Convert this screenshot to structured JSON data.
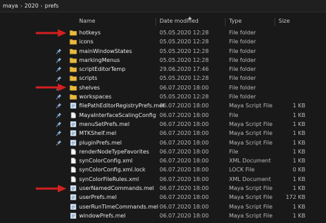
{
  "breadcrumbs": [
    "maya",
    "2020",
    "prefs"
  ],
  "columns": {
    "name": "Name",
    "date": "Date modified",
    "type": "Type",
    "size": "Size"
  },
  "icons": {
    "folder": "folder-icon",
    "file": "file-icon",
    "mel": "mel-script-icon",
    "pin": "pin-icon",
    "arrow": "red-arrow-icon"
  },
  "colors": {
    "folder": "#e8b83d",
    "arrow": "#d42020",
    "background": "#191919"
  },
  "files": [
    {
      "name": "hotkeys",
      "date": "05.05.2020 12:28",
      "type": "File folder",
      "size": "",
      "kind": "folder",
      "pinned": false,
      "arrow": true
    },
    {
      "name": "icons",
      "date": "05.05.2020 12:28",
      "type": "File folder",
      "size": "",
      "kind": "folder",
      "pinned": false,
      "arrow": false
    },
    {
      "name": "mainWindowStates",
      "date": "05.05.2020 12:28",
      "type": "File folder",
      "size": "",
      "kind": "folder",
      "pinned": true,
      "arrow": false
    },
    {
      "name": "markingMenus",
      "date": "05.05.2020 12:28",
      "type": "File folder",
      "size": "",
      "kind": "folder",
      "pinned": true,
      "arrow": false
    },
    {
      "name": "scriptEditorTemp",
      "date": "29.06.2020 17:46",
      "type": "File folder",
      "size": "",
      "kind": "folder",
      "pinned": true,
      "arrow": false
    },
    {
      "name": "scripts",
      "date": "05.05.2020 12:28",
      "type": "File folder",
      "size": "",
      "kind": "folder",
      "pinned": true,
      "arrow": false
    },
    {
      "name": "shelves",
      "date": "06.07.2020 18:00",
      "type": "File folder",
      "size": "",
      "kind": "folder",
      "pinned": true,
      "arrow": true
    },
    {
      "name": "workspaces",
      "date": "05.05.2020 12:28",
      "type": "File folder",
      "size": "",
      "kind": "folder",
      "pinned": true,
      "arrow": false
    },
    {
      "name": "filePathEditorRegistryPrefs.mel",
      "date": "06.07.2020 18:00",
      "type": "Maya Script File",
      "size": "1 KB",
      "kind": "mel",
      "pinned": true,
      "arrow": false
    },
    {
      "name": "MayaInterfaceScalingConfig",
      "date": "06.07.2020 18:00",
      "type": "File",
      "size": "1 KB",
      "kind": "file",
      "pinned": true,
      "arrow": false
    },
    {
      "name": "menuSetPrefs.mel",
      "date": "06.07.2020 18:00",
      "type": "Maya Script File",
      "size": "1 KB",
      "kind": "mel",
      "pinned": true,
      "arrow": false
    },
    {
      "name": "MTKShelf.mel",
      "date": "06.07.2020 18:00",
      "type": "Maya Script File",
      "size": "1 KB",
      "kind": "mel",
      "pinned": true,
      "arrow": false
    },
    {
      "name": "pluginPrefs.mel",
      "date": "06.07.2020 18:00",
      "type": "Maya Script File",
      "size": "1 KB",
      "kind": "mel",
      "pinned": true,
      "arrow": false
    },
    {
      "name": "renderNodeTypeFavorites",
      "date": "06.07.2020 18:00",
      "type": "File",
      "size": "1 KB",
      "kind": "file",
      "pinned": false,
      "arrow": false
    },
    {
      "name": "synColorConfig.xml",
      "date": "06.07.2020 18:00",
      "type": "XML Document",
      "size": "1 KB",
      "kind": "file",
      "pinned": false,
      "arrow": false
    },
    {
      "name": "synColorConfig.xml.lock",
      "date": "06.07.2020 18:00",
      "type": "LOCK File",
      "size": "0 KB",
      "kind": "file",
      "pinned": false,
      "arrow": false
    },
    {
      "name": "synColorFileRules.xml",
      "date": "06.07.2020 18:00",
      "type": "XML Document",
      "size": "1 KB",
      "kind": "file",
      "pinned": false,
      "arrow": false
    },
    {
      "name": "userNamedCommands.mel",
      "date": "06.07.2020 18:00",
      "type": "Maya Script File",
      "size": "1 KB",
      "kind": "mel",
      "pinned": false,
      "arrow": true
    },
    {
      "name": "userPrefs.mel",
      "date": "06.07.2020 18:00",
      "type": "Maya Script File",
      "size": "172 KB",
      "kind": "mel",
      "pinned": false,
      "arrow": false
    },
    {
      "name": "userRunTimeCommands.mel",
      "date": "06.07.2020 18:00",
      "type": "Maya Script File",
      "size": "1 KB",
      "kind": "mel",
      "pinned": false,
      "arrow": false
    },
    {
      "name": "windowPrefs.mel",
      "date": "06.07.2020 18:00",
      "type": "Maya Script File",
      "size": "1 KB",
      "kind": "mel",
      "pinned": false,
      "arrow": false
    }
  ]
}
